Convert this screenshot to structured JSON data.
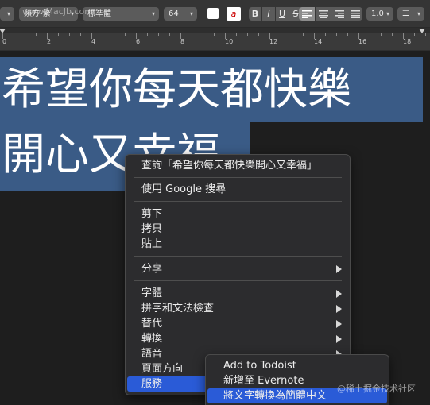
{
  "watermark_top": "www.MacJb.com",
  "watermark_bottom": "@稀土掘金技术社区",
  "toolbar": {
    "font_family": "蘋方-繁",
    "font_style": "標準體",
    "font_size": "64",
    "bold": "B",
    "italic": "I",
    "underline": "U",
    "strike": "S",
    "text_color_glyph": "a",
    "line_spacing": "1.0",
    "list_style": "☰"
  },
  "ruler": {
    "numbers": [
      "0",
      "2",
      "4",
      "6",
      "8",
      "10",
      "12",
      "14",
      "16",
      "18"
    ]
  },
  "document": {
    "line1": "希望你每天都快樂",
    "line2": "開心又幸福"
  },
  "context_menu": {
    "items": [
      {
        "label": "查詢「希望你每天都快樂開心又幸福」"
      },
      {
        "label": "使用 Google 搜尋"
      },
      {
        "label": "剪下"
      },
      {
        "label": "拷貝"
      },
      {
        "label": "貼上"
      },
      {
        "label": "分享"
      },
      {
        "label": "字體"
      },
      {
        "label": "拼字和文法檢查"
      },
      {
        "label": "替代"
      },
      {
        "label": "轉換"
      },
      {
        "label": "語音"
      },
      {
        "label": "頁面方向"
      },
      {
        "label": "服務"
      }
    ]
  },
  "services_menu": {
    "items": [
      {
        "label": "Add to Todoist"
      },
      {
        "label": "新增至 Evernote"
      },
      {
        "label": "將文字轉換為簡體中文"
      }
    ]
  },
  "colors": {
    "selection": "#3a5b86",
    "menu_highlight": "#2a5bd7"
  }
}
